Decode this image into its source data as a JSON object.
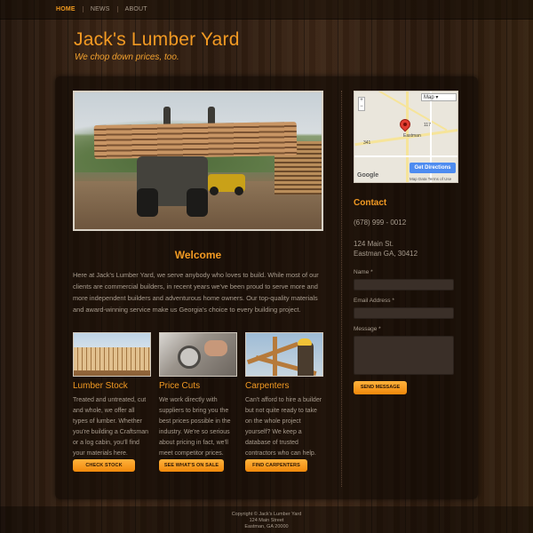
{
  "nav": {
    "items": [
      {
        "label": "HOME",
        "active": true
      },
      {
        "label": "NEWS",
        "active": false
      },
      {
        "label": "ABOUT",
        "active": false
      }
    ]
  },
  "header": {
    "title": "Jack's Lumber Yard",
    "tagline": "We chop down prices, too."
  },
  "welcome": {
    "title": "Welcome",
    "text": "Here at Jack's Lumber Yard, we serve anybody who loves to build. While most of our clients are commercial builders, in recent years we've been proud to serve more and more independent builders and adventurous home owners. Our top-quality materials and award-winning service make us Georgia's choice to every building project."
  },
  "features": [
    {
      "title": "Lumber Stock",
      "text": "Treated and untreated, cut and whole, we offer all types of lumber. Whether you're building a Craftsman or a log cabin, you'll find your materials here.",
      "button": "CHECK STOCK"
    },
    {
      "title": "Price Cuts",
      "text": "We work directly with suppliers to bring you the best prices possible in the industry. We're so serious about pricing in fact, we'll meet competitor prices.",
      "button": "SEE WHAT'S ON SALE"
    },
    {
      "title": "Carpenters",
      "text": "Can't afford to hire a builder but not quite ready to take on the whole project yourself? We keep a database of trusted contractors who can help.",
      "button": "FIND CARPENTERS"
    }
  ],
  "map": {
    "type_select": "Map",
    "directions_button": "Get Directions",
    "attribution": "Map Data   Terms of Use",
    "brand": "Google",
    "town_label": "Eastman",
    "route_label": "117",
    "route_label_2": "341"
  },
  "contact": {
    "title": "Contact",
    "phone": "(678) 999 - 0012",
    "address_line1": "124 Main St.",
    "address_line2": "Eastman GA, 30412"
  },
  "form": {
    "name_label": "Name *",
    "email_label": "Email Address *",
    "message_label": "Message *",
    "send_button": "SEND MESSAGE"
  },
  "footer": {
    "copyright": "Copyright © Jack's Lumber Yard",
    "street": "124 Main Street",
    "city": "Eastman, GA 20000"
  },
  "colors": {
    "accent": "#f29a23",
    "button": "#f0880b",
    "background": "#2a1a0f"
  }
}
